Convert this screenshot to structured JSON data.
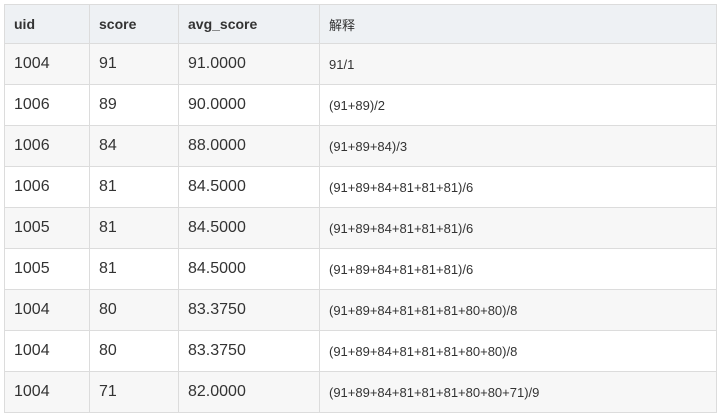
{
  "table": {
    "columns": [
      "uid",
      "score",
      "avg_score",
      "解释"
    ],
    "rows": [
      {
        "uid": "1004",
        "score": "91",
        "avg_score": "91.0000",
        "explain": "91/1"
      },
      {
        "uid": "1006",
        "score": "89",
        "avg_score": "90.0000",
        "explain": "(91+89)/2"
      },
      {
        "uid": "1006",
        "score": "84",
        "avg_score": "88.0000",
        "explain": "(91+89+84)/3"
      },
      {
        "uid": "1006",
        "score": "81",
        "avg_score": "84.5000",
        "explain": "(91+89+84+81+81+81)/6"
      },
      {
        "uid": "1005",
        "score": "81",
        "avg_score": "84.5000",
        "explain": "(91+89+84+81+81+81)/6"
      },
      {
        "uid": "1005",
        "score": "81",
        "avg_score": "84.5000",
        "explain": "(91+89+84+81+81+81)/6"
      },
      {
        "uid": "1004",
        "score": "80",
        "avg_score": "83.3750",
        "explain": "(91+89+84+81+81+81+80+80)/8"
      },
      {
        "uid": "1004",
        "score": "80",
        "avg_score": "83.3750",
        "explain": "(91+89+84+81+81+81+80+80)/8"
      },
      {
        "uid": "1004",
        "score": "71",
        "avg_score": "82.0000",
        "explain": "(91+89+84+81+81+81+80+80+71)/9"
      }
    ]
  }
}
